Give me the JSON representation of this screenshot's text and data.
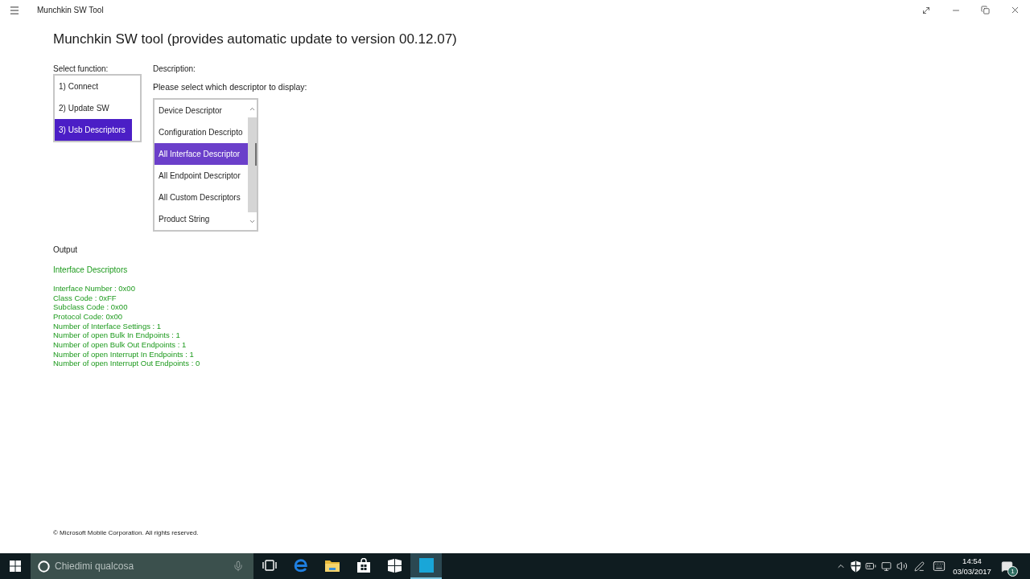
{
  "window": {
    "title": "Munchkin SW Tool"
  },
  "heading": "Munchkin SW tool (provides automatic update to version 00.12.07)",
  "functions": {
    "label": "Select function:",
    "items": [
      {
        "label": "1) Connect",
        "selected": false
      },
      {
        "label": "2) Update SW",
        "selected": false
      },
      {
        "label": "3) Usb Descriptors",
        "selected": true
      }
    ]
  },
  "description": {
    "label": "Description:",
    "prompt": "Please select which descriptor to display:",
    "items": [
      {
        "label": "Device Descriptor",
        "selected": false
      },
      {
        "label": "Configuration Descripto",
        "selected": false
      },
      {
        "label": "All Interface Descriptor",
        "selected": true
      },
      {
        "label": "All Endpoint Descriptor",
        "selected": false
      },
      {
        "label": "All Custom Descriptors",
        "selected": false
      },
      {
        "label": "Product String",
        "selected": false
      }
    ]
  },
  "output": {
    "label": "Output",
    "title": "Interface Descriptors",
    "lines": [
      "Interface Number : 0x00",
      "Class Code : 0xFF",
      "Subclass Code : 0x00",
      "Protocol Code: 0x00",
      "Number of Interface Settings : 1",
      "Number of open Bulk In Endpoints : 1",
      "Number of open Bulk Out Endpoints : 1",
      "Number of open Interrupt In Endpoints : 1",
      "Number of open Interrupt Out Endpoints : 0"
    ]
  },
  "footer": "© Microsoft Mobile Corporation. All rights reserved.",
  "taskbar": {
    "search": {
      "placeholder": "Chiedimi qualcosa"
    },
    "apps": [
      {
        "kind": "task-view",
        "selected": false
      },
      {
        "kind": "browser",
        "selected": false
      },
      {
        "kind": "folder",
        "selected": false
      },
      {
        "kind": "store",
        "selected": false
      },
      {
        "kind": "tiles",
        "selected": false
      },
      {
        "kind": "app",
        "selected": true
      }
    ],
    "clock": {
      "time": "14:54",
      "date": "03/03/2017"
    },
    "notifications": {
      "count": "1"
    }
  }
}
